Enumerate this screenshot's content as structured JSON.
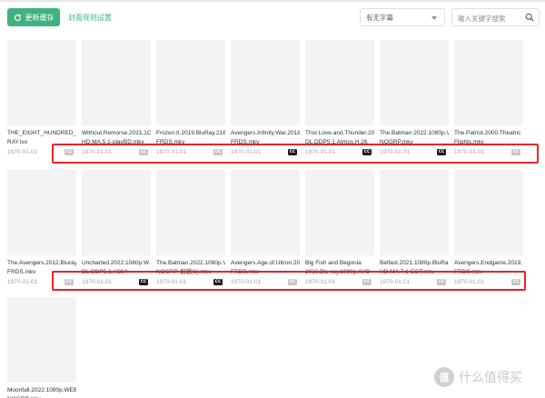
{
  "toolbar": {
    "refresh_label": "更新缓存",
    "rules_link": "封面规则设置",
    "subtitle_filter": "有无字幕",
    "search_placeholder": "输入关键字搜索"
  },
  "cc_label": "CC",
  "media": [
    {
      "title": [
        "THE_EIGHT_HUNDRED_BI",
        "RAY.iso"
      ],
      "date": "1970-01-01",
      "subtitle": false
    },
    {
      "title": [
        "Without.Remorse.2021.1C",
        "HD.MA.5.1-playBD.mkv"
      ],
      "date": "1970-01-01",
      "subtitle": false
    },
    {
      "title": [
        "Frozen.II.2019.BluRay.216",
        "FRDS.mkv"
      ],
      "date": "1970-01-01",
      "subtitle": false
    },
    {
      "title": [
        "Avengers.Infinity.War.2018",
        "FRDS.mkv"
      ],
      "date": "1970-01-01",
      "subtitle": true
    },
    {
      "title": [
        "Thor.Love.and.Thunder.20",
        "DL.DDP5.1.Atmos.H.26"
      ],
      "date": "1970-01-01",
      "subtitle": true
    },
    {
      "title": [
        "The.Batman.2022.1080p.V",
        "NOGRP.mkv"
      ],
      "date": "1970-01-01",
      "subtitle": true
    },
    {
      "title": [
        "The.Patriot.2000.Theatric",
        "Flights.mkv"
      ],
      "date": "1970-01-01",
      "subtitle": false
    },
    {
      "title": [
        "The.Avengers.2012.Bluray",
        "FRDS.mkv"
      ],
      "date": "1970-01-01",
      "subtitle": false
    },
    {
      "title": [
        "Uncharted.2022.1080p.W",
        "DL.DDP5.1.H264-"
      ],
      "date": "1970-01-01",
      "subtitle": true
    },
    {
      "title": [
        "The.Batman.2022.1080p.V",
        "NOGRP-剪辑(1).mkv"
      ],
      "date": "1970-01-01",
      "subtitle": true
    },
    {
      "title": [
        "Avengers.Age.of.Ultron.20",
        "FRDS.mkv"
      ],
      "date": "1970-01-01",
      "subtitle": false
    },
    {
      "title": [
        "Big Fish and Begonia",
        "2016.Blu-ray.1080p.AVC"
      ],
      "date": "1970-01-01",
      "subtitle": false
    },
    {
      "title": [
        "Belfast.2021.1080p.BluRa",
        "HD.MA.7.1-EGT.mkv"
      ],
      "date": "1970-01-01",
      "subtitle": false
    },
    {
      "title": [
        "Avengers.Endgame.2019.",
        "FRDS.mkv"
      ],
      "date": "1970-01-01",
      "subtitle": false
    },
    {
      "title": [
        "Moonfall.2022.1080p.WEB",
        "NOGRP.mkv"
      ],
      "date": "",
      "subtitle": false
    }
  ],
  "watermark": {
    "badge": "值",
    "text": "什么值得买"
  },
  "colors": {
    "accent": "#3fb37f",
    "highlight": "#e5252a",
    "cc_on": "#1a1a1a",
    "cc_off": "#c3c5c9"
  }
}
